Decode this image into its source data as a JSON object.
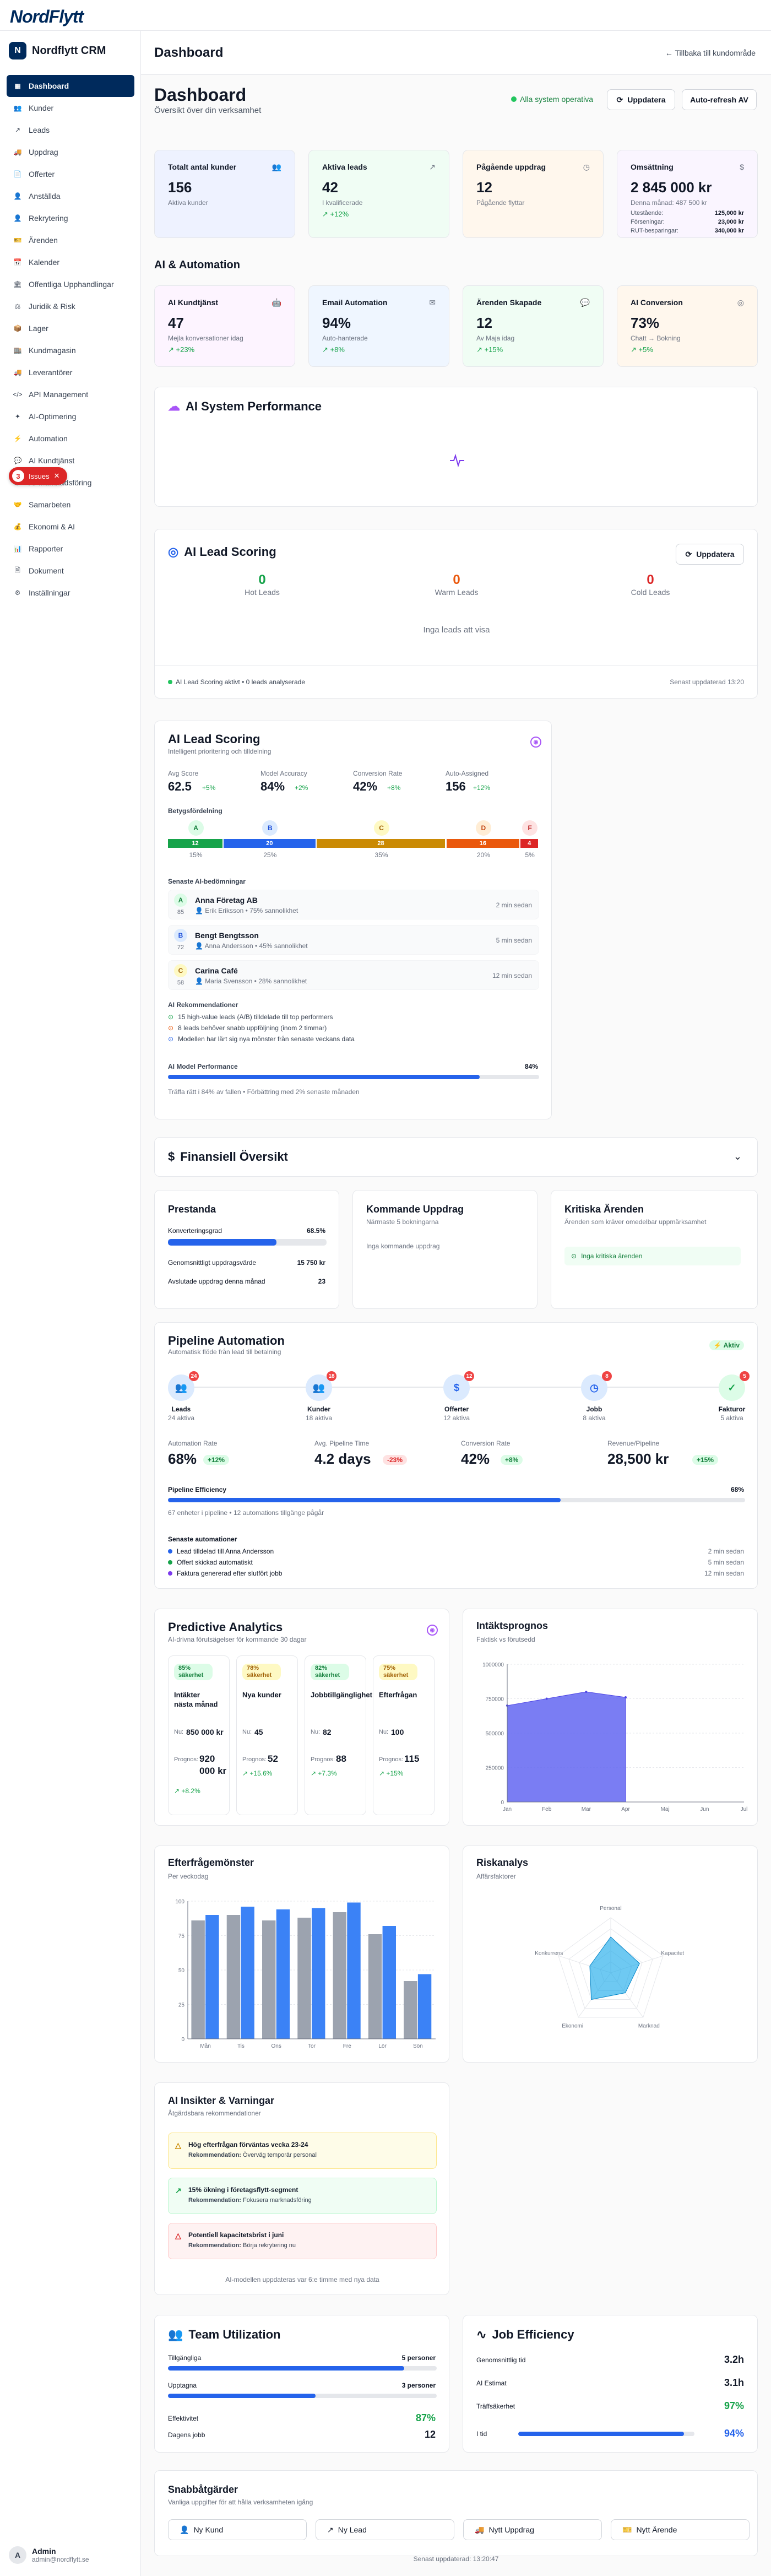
{
  "app": {
    "logo": "NordFlytt",
    "brand": "Nordflytt CRM",
    "brand_initial": "N"
  },
  "sidebar": {
    "items": [
      {
        "label": "Dashboard",
        "icon": "grid",
        "active": true
      },
      {
        "label": "Kunder",
        "icon": "users"
      },
      {
        "label": "Leads",
        "icon": "trend"
      },
      {
        "label": "Uppdrag",
        "icon": "truck"
      },
      {
        "label": "Offerter",
        "icon": "doc"
      },
      {
        "label": "Anställda",
        "icon": "person"
      },
      {
        "label": "Rekrytering",
        "icon": "person-plus"
      },
      {
        "label": "Ärenden",
        "icon": "ticket"
      },
      {
        "label": "Kalender",
        "icon": "calendar"
      },
      {
        "label": "Offentliga Upphandlingar",
        "icon": "building"
      },
      {
        "label": "Juridik & Risk",
        "icon": "scale"
      },
      {
        "label": "Lager",
        "icon": "box"
      },
      {
        "label": "Kundmagasin",
        "icon": "warehouse"
      },
      {
        "label": "Leverantörer",
        "icon": "truck"
      },
      {
        "label": "API Management",
        "icon": "code"
      },
      {
        "label": "AI-Optimering",
        "icon": "sparkle"
      },
      {
        "label": "Automation",
        "icon": "bolt"
      },
      {
        "label": "AI Kundtjänst",
        "icon": "chat"
      },
      {
        "label": "AI-Marknadsföring",
        "icon": "megaphone"
      },
      {
        "label": "Samarbeten",
        "icon": "handshake"
      },
      {
        "label": "Ekonomi & AI",
        "icon": "money"
      },
      {
        "label": "Rapporter",
        "icon": "chart"
      },
      {
        "label": "Dokument",
        "icon": "file"
      },
      {
        "label": "Inställningar",
        "icon": "gear"
      }
    ],
    "issues_count": "3",
    "issues_label": "Issues",
    "user": {
      "initial": "A",
      "name": "Admin",
      "email": "admin@nordflytt.se"
    }
  },
  "header": {
    "title": "Dashboard",
    "back": "← Tillbaka till kundområde"
  },
  "page": {
    "title": "Dashboard",
    "subtitle": "Översikt över din verksamhet",
    "system_ok": "Alla system operativa",
    "refresh": "Uppdatera",
    "autorefresh": "Auto-refresh AV"
  },
  "kpis": [
    {
      "label": "Totalt antal kunder",
      "value": "156",
      "sub": "Aktiva kunder",
      "trend": "",
      "icon": "users",
      "bg": "#eef2ff"
    },
    {
      "label": "Aktiva leads",
      "value": "42",
      "sub": "I kvalificerade",
      "trend": "+12%",
      "icon": "trend",
      "bg": "#f0fdf4"
    },
    {
      "label": "Pågående uppdrag",
      "value": "12",
      "sub": "Pågående flyttar",
      "trend": "",
      "icon": "gauge",
      "bg": "#fff7ed"
    },
    {
      "label": "Omsättning",
      "value": "2 845 000 kr",
      "sub": "Denna månad: 487 500 kr",
      "icon": "dollar",
      "bg": "#faf5ff",
      "lines": [
        {
          "k": "Utestående:",
          "v": "125,000 kr"
        },
        {
          "k": "Förseningar:",
          "v": "23,000 kr"
        },
        {
          "k": "RUT-besparingar:",
          "v": "340,000 kr"
        }
      ]
    }
  ],
  "ai_automation": {
    "title": "AI & Automation",
    "cards": [
      {
        "label": "AI Kundtjänst",
        "value": "47",
        "sub": "Mejla konversationer idag",
        "trend": "+23%",
        "icon": "bot",
        "bg": "#fdf4ff"
      },
      {
        "label": "Email Automation",
        "value": "94%",
        "sub": "Auto-hanterade",
        "trend": "+8%",
        "icon": "mail",
        "bg": "#eff6ff"
      },
      {
        "label": "Ärenden Skapade",
        "value": "12",
        "sub": "Av Maja idag",
        "trend": "+15%",
        "icon": "chat",
        "bg": "#f0fdf4"
      },
      {
        "label": "AI Conversion",
        "value": "73%",
        "sub": "Chatt → Bokning",
        "trend": "+5%",
        "icon": "target",
        "bg": "#fff7ed"
      }
    ]
  },
  "ai_system_performance": {
    "title": "AI System Performance"
  },
  "ai_lead_scoring_top": {
    "title": "AI Lead Scoring",
    "refresh": "Uppdatera",
    "hot": {
      "n": "0",
      "l": "Hot Leads"
    },
    "warm": {
      "n": "0",
      "l": "Warm Leads"
    },
    "cold": {
      "n": "0",
      "l": "Cold Leads"
    },
    "empty": "Inga leads att visa",
    "status": "AI Lead Scoring aktivt • 0 leads analyserade",
    "updated": "Senast uppdaterad 13:20"
  },
  "ai_lead_scoring": {
    "title": "AI Lead Scoring",
    "subtitle": "Intelligent prioritering och tilldelning",
    "stats": [
      {
        "label": "Avg Score",
        "value": "62.5",
        "delta": "+5%"
      },
      {
        "label": "Model Accuracy",
        "value": "84%",
        "delta": "+2%"
      },
      {
        "label": "Conversion Rate",
        "value": "42%",
        "delta": "+8%"
      },
      {
        "label": "Auto-Assigned",
        "value": "156",
        "delta": "+12%"
      }
    ],
    "dist_title": "Betygsfördelning",
    "dist": [
      {
        "grade": "A",
        "count": "12",
        "pct": "15%",
        "share": 0.15,
        "color": "#16a34a",
        "bg": "#dcfce7",
        "fg": "#15803d"
      },
      {
        "grade": "B",
        "count": "20",
        "pct": "25%",
        "share": 0.25,
        "color": "#2563eb",
        "bg": "#dbeafe",
        "fg": "#1d4ed8"
      },
      {
        "grade": "C",
        "count": "28",
        "pct": "35%",
        "share": 0.35,
        "color": "#ca8a04",
        "bg": "#fef9c3",
        "fg": "#a16207"
      },
      {
        "grade": "D",
        "count": "16",
        "pct": "20%",
        "share": 0.2,
        "color": "#ea580c",
        "bg": "#ffedd5",
        "fg": "#c2410c"
      },
      {
        "grade": "F",
        "count": "4",
        "pct": "5%",
        "share": 0.05,
        "color": "#dc2626",
        "bg": "#fee2e2",
        "fg": "#b91c1c"
      }
    ],
    "recent_title": "Senaste AI-bedömningar",
    "recent": [
      {
        "grade": "A",
        "score": "85",
        "name": "Anna Företag AB",
        "meta": "Erik Eriksson • 75% sannolikhet",
        "time": "2 min sedan",
        "bg": "#dcfce7",
        "fg": "#15803d"
      },
      {
        "grade": "B",
        "score": "72",
        "name": "Bengt Bengtsson",
        "meta": "Anna Andersson • 45% sannolikhet",
        "time": "5 min sedan",
        "bg": "#dbeafe",
        "fg": "#1d4ed8"
      },
      {
        "grade": "C",
        "score": "58",
        "name": "Carina Café",
        "meta": "Maria Svensson • 28% sannolikhet",
        "time": "12 min sedan",
        "bg": "#fef9c3",
        "fg": "#a16207"
      }
    ],
    "rec_title": "AI Rekommendationer",
    "recs": [
      "15 high-value leads (A/B) tilldelade till top performers",
      "8 leads behöver snabb uppföljning (inom 2 timmar)",
      "Modellen har lärt sig nya mönster från senaste veckans data"
    ],
    "perf_label": "AI Model Performance",
    "perf_value": "84%",
    "perf": 0.84,
    "perf_note": "Träffa rätt i 84% av fallen • Förbättring med 2% senaste månaden"
  },
  "finance": {
    "title": "Finansiell Översikt"
  },
  "prestanda": {
    "title": "Prestanda",
    "conv_label": "Konverteringsgrad",
    "conv_value": "68.5%",
    "conv": 0.685,
    "avg_label": "Genomsnittligt uppdragsvärde",
    "avg_value": "15 750 kr",
    "done_label": "Avslutade uppdrag denna månad",
    "done_value": "23"
  },
  "upcoming": {
    "title": "Kommande Uppdrag",
    "subtitle": "Närmaste 5 bokningarna",
    "empty": "Inga kommande uppdrag"
  },
  "critical": {
    "title": "Kritiska Ärenden",
    "subtitle": "Ärenden som kräver omedelbar uppmärksamhet",
    "ok": "Inga kritiska ärenden"
  },
  "pipeline": {
    "title": "Pipeline Automation",
    "subtitle": "Automatisk flöde från lead till betalning",
    "badge": "Aktiv",
    "stages": [
      {
        "label": "Leads",
        "count": "24",
        "sub": "24 aktiva",
        "icon": "users",
        "bg": "#dbeafe",
        "fg": "#2563eb"
      },
      {
        "label": "Kunder",
        "count": "18",
        "sub": "18 aktiva",
        "icon": "users",
        "bg": "#dbeafe",
        "fg": "#2563eb"
      },
      {
        "label": "Offerter",
        "count": "12",
        "sub": "12 aktiva",
        "icon": "dollar",
        "bg": "#dbeafe",
        "fg": "#2563eb"
      },
      {
        "label": "Jobb",
        "count": "8",
        "sub": "8 aktiva",
        "icon": "clock",
        "bg": "#dbeafe",
        "fg": "#2563eb"
      },
      {
        "label": "Fakturor",
        "count": "5",
        "sub": "5 aktiva",
        "icon": "check",
        "bg": "#dcfce7",
        "fg": "#16a34a"
      }
    ],
    "stats": [
      {
        "label": "Automation Rate",
        "value": "68%",
        "delta": "+12%",
        "cls": "g"
      },
      {
        "label": "Avg. Pipeline Time",
        "value": "4.2 days",
        "delta": "-23%",
        "cls": "r"
      },
      {
        "label": "Conversion Rate",
        "value": "42%",
        "delta": "+8%",
        "cls": "g"
      },
      {
        "label": "Revenue/Pipeline",
        "value": "28,500 kr",
        "delta": "+15%",
        "cls": "g"
      }
    ],
    "eff_label": "Pipeline Efficiency",
    "eff_value": "68%",
    "eff": 0.68,
    "eff_note": "67 enheter i pipeline • 12 automations tillgänge pågår",
    "recent_title": "Senaste automationer",
    "recent": [
      {
        "text": "Lead tilldelad till Anna Andersson",
        "time": "2 min sedan",
        "color": "#2563eb"
      },
      {
        "text": "Offert skickad automatiskt",
        "time": "5 min sedan",
        "color": "#16a34a"
      },
      {
        "text": "Faktura genererad efter slutfört jobb",
        "time": "12 min sedan",
        "color": "#7c3aed"
      }
    ]
  },
  "predictive": {
    "title": "Predictive Analytics",
    "subtitle": "AI-drivna förutsägelser för kommande 30 dagar",
    "cards": [
      {
        "conf": "85% säkerhet",
        "title": "Intäkter nästa månad",
        "now_l": "Nu:",
        "now": "850 000 kr",
        "pred_l": "Prognos:",
        "pred": "920 000 kr",
        "delta": "+8.2%",
        "cbg": "#dcfce7",
        "cfg": "#15803d"
      },
      {
        "conf": "78% säkerhet",
        "title": "Nya kunder",
        "now_l": "Nu:",
        "now": "45",
        "pred_l": "Prognos:",
        "pred": "52",
        "delta": "+15.6%",
        "cbg": "#fef9c3",
        "cfg": "#a16207"
      },
      {
        "conf": "82% säkerhet",
        "title": "Jobbtillgänglighet",
        "now_l": "Nu:",
        "now": "82",
        "pred_l": "Prognos:",
        "pred": "88",
        "delta": "+7.3%",
        "cbg": "#dcfce7",
        "cfg": "#15803d"
      },
      {
        "conf": "75% säkerhet",
        "title": "Efterfrågan",
        "now_l": "Nu:",
        "now": "100",
        "pred_l": "Prognos:",
        "pred": "115",
        "delta": "+15%",
        "cbg": "#fef9c3",
        "cfg": "#a16207"
      }
    ]
  },
  "revenue_forecast": {
    "title": "Intäktsprognos",
    "subtitle": "Faktisk vs förutsedd"
  },
  "demand": {
    "title": "Efterfrågemönster",
    "subtitle": "Per veckodag"
  },
  "risk": {
    "title": "Riskanalys",
    "subtitle": "Affärsfaktorer"
  },
  "insights": {
    "title": "AI Insikter & Varningar",
    "subtitle": "Åtgärdsbara rekommendationer",
    "items": [
      {
        "title": "Hög efterfrågan förväntas vecka 23-24",
        "rec_l": "Rekommendation:",
        "rec": "Överväg temporär personal",
        "bg": "#fefce8",
        "bd": "#fde68a",
        "ic": "#ca8a04",
        "icon": "△"
      },
      {
        "title": "15% ökning i företagsflytt-segment",
        "rec_l": "Rekommendation:",
        "rec": "Fokusera marknadsföring",
        "bg": "#f0fdf4",
        "bd": "#bbf7d0",
        "ic": "#16a34a",
        "icon": "↗"
      },
      {
        "title": "Potentiell kapacitetsbrist i juni",
        "rec_l": "Rekommendation:",
        "rec": "Börja rekrytering nu",
        "bg": "#fef2f2",
        "bd": "#fecaca",
        "ic": "#dc2626",
        "icon": "△"
      }
    ],
    "footer": "AI-modellen uppdateras var 6:e timme med nya data"
  },
  "team": {
    "title": "Team Utilization",
    "avail_l": "Tillgängliga",
    "avail_v": "5 personer",
    "avail": 0.88,
    "busy_l": "Upptagna",
    "busy_v": "3 personer",
    "busy": 0.55,
    "eff_l": "Effektivitet",
    "eff_v": "87%",
    "jobs_l": "Dagens jobb",
    "jobs_v": "12"
  },
  "job_eff": {
    "title": "Job Efficiency",
    "rows": [
      {
        "k": "Genomsnittlig tid",
        "v": "3.2h",
        "cls": ""
      },
      {
        "k": "AI Estimat",
        "v": "3.1h",
        "cls": ""
      },
      {
        "k": "Träffsäkerhet",
        "v": "97%",
        "cls": "green"
      }
    ],
    "ontime_l": "I tid",
    "ontime_v": "94%",
    "ontime": 0.94
  },
  "quick": {
    "title": "Snabbåtgärder",
    "subtitle": "Vanliga uppgifter för att hålla verksamheten igång",
    "actions": [
      {
        "label": "Ny Kund",
        "icon": "person-plus"
      },
      {
        "label": "Ny Lead",
        "icon": "trend"
      },
      {
        "label": "Nytt Uppdrag",
        "icon": "truck"
      },
      {
        "label": "Nytt Ärende",
        "icon": "ticket"
      }
    ]
  },
  "footer": {
    "updated": "Senast uppdaterad: 13:20:47"
  },
  "chart_data": [
    {
      "type": "area",
      "title": "Intäktsprognos",
      "subtitle": "Faktisk vs förutsedd",
      "categories": [
        "Jan",
        "Feb",
        "Mar",
        "Apr",
        "Maj",
        "Jun",
        "Jul"
      ],
      "ylim": [
        0,
        1000000
      ],
      "yticks": [
        0,
        250000,
        500000,
        750000,
        1000000
      ],
      "series": [
        {
          "name": "",
          "values": [
            700000,
            750000,
            800000,
            760000,
            null,
            null,
            null
          ],
          "color": "#6366f1"
        }
      ]
    },
    {
      "type": "bar",
      "title": "Efterfrågemönster",
      "subtitle": "Per veckodag",
      "categories": [
        "Mån",
        "Tis",
        "Ons",
        "Tor",
        "Fre",
        "Lör",
        "Sön"
      ],
      "ylim": [
        0,
        100
      ],
      "yticks": [
        0,
        25,
        50,
        75,
        100
      ],
      "series": [
        {
          "name": "",
          "values": [
            86,
            90,
            86,
            88,
            92,
            76,
            42
          ],
          "color": "#9ca3af"
        },
        {
          "name": "",
          "values": [
            90,
            96,
            94,
            95,
            99,
            82,
            47
          ],
          "color": "#3b82f6"
        }
      ]
    },
    {
      "type": "radar",
      "title": "Riskanalys",
      "subtitle": "Affärsfaktorer",
      "categories": [
        "Personal",
        "Kapacitet",
        "Marknad",
        "Ekonomi",
        "Konkurrens"
      ],
      "max": 100,
      "series": [
        {
          "name": "",
          "values": [
            65,
            55,
            45,
            60,
            40
          ],
          "color": "#0ea5e9"
        }
      ]
    }
  ]
}
